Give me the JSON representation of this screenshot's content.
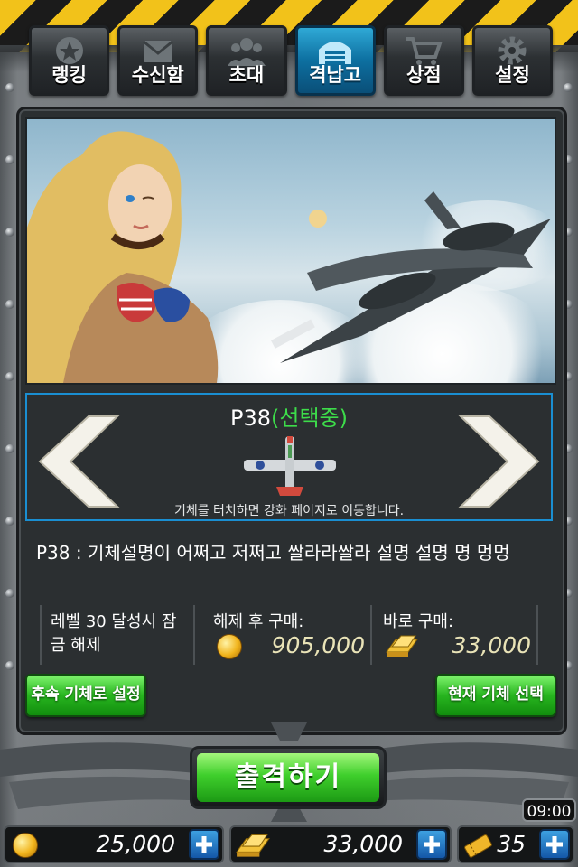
{
  "nav": {
    "tabs": [
      {
        "label": "랭킹",
        "icon": "star-wings-icon",
        "active": false
      },
      {
        "label": "수신함",
        "icon": "mail-icon",
        "active": false
      },
      {
        "label": "초대",
        "icon": "people-icon",
        "active": false
      },
      {
        "label": "격납고",
        "icon": "hangar-icon",
        "active": true
      },
      {
        "label": "상점",
        "icon": "cart-icon",
        "active": false
      },
      {
        "label": "설정",
        "icon": "gear-icon",
        "active": false
      }
    ]
  },
  "aircraft": {
    "name": "P38",
    "state": "(선택중)",
    "hint": "기체를 터치하면 강화 페이지로 이동합니다."
  },
  "description": {
    "text": "P38 : 기체설명이 어쩌고 저쩌고 쌀라라쌀라 설명 설명 명 멍멍",
    "unlock_condition": "레벨 30 달성시 잠금 해제",
    "after_unlock_label": "해제 후 구매:",
    "after_unlock_price": "905,000",
    "buy_now_label": "바로 구매:",
    "buy_now_price": "33,000"
  },
  "buttons": {
    "set_successor": "후속 기체로 설정",
    "select_current": "현재 기체 선택",
    "sortie": "출격하기"
  },
  "clock": "09:00",
  "currency": {
    "gold": "25,000",
    "bars": "33,000",
    "tickets": "35"
  },
  "colors": {
    "accent_blue": "#1a8fd2",
    "selected_green": "#3ddc4a",
    "button_green": "#27b51f"
  }
}
